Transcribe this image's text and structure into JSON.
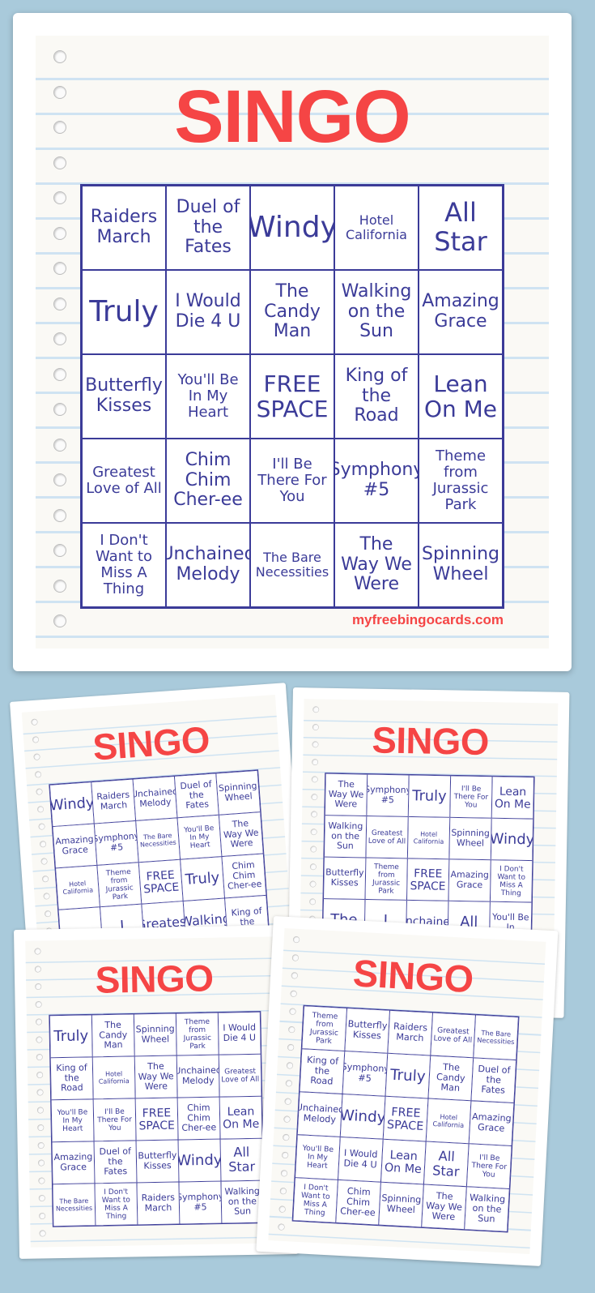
{
  "colors": {
    "background": "#a9cadb",
    "title": "#f54545",
    "grid": "#3b3b98",
    "rule_lines": "#cfe3f2"
  },
  "cards": [
    {
      "title": "SINGO",
      "site": "myfreebingocards.com",
      "cells": [
        "Raiders March",
        "Duel of the Fates",
        "Windy",
        "Hotel California",
        "All Star",
        "Truly",
        "I Would Die 4 U",
        "The Candy Man",
        "Walking on the Sun",
        "Amazing Grace",
        "Butterfly Kisses",
        "You'll Be In My Heart",
        "FREE SPACE",
        "King of the Road",
        "Lean On Me",
        "Greatest Love of All",
        "Chim Chim Cher-ee",
        "I'll Be There For You",
        "Symphony #5",
        "Theme from Jurassic Park",
        "I Don't Want to Miss A Thing",
        "Unchained Melody",
        "The Bare Necessities",
        "The Way We Were",
        "Spinning Wheel"
      ]
    },
    {
      "title": "SINGO",
      "cells": [
        "Windy",
        "Raiders March",
        "Unchained Melody",
        "Duel of the Fates",
        "Spinning Wheel",
        "Amazing Grace",
        "Symphony #5",
        "The Bare Necessities",
        "You'll Be In My Heart",
        "The Way We Were",
        "Hotel California",
        "Theme from Jurassic Park",
        "FREE SPACE",
        "Truly",
        "Chim Chim Cher-ee",
        "",
        "I",
        "Greatest",
        "Walking",
        "King of the",
        "",
        "",
        "",
        "",
        ""
      ]
    },
    {
      "title": "SINGO",
      "cells": [
        "The Way We Were",
        "Symphony #5",
        "Truly",
        "I'll Be There For You",
        "Lean On Me",
        "Walking on the Sun",
        "Greatest Love of All",
        "Hotel California",
        "Spinning Wheel",
        "Windy",
        "Butterfly Kisses",
        "Theme from Jurassic Park",
        "FREE SPACE",
        "Amazing Grace",
        "I Don't Want to Miss A Thing",
        "The",
        "I",
        "Unchained",
        "All",
        "You'll Be In",
        "",
        "",
        "",
        "",
        ""
      ]
    },
    {
      "title": "SINGO",
      "cells": [
        "Truly",
        "The Candy Man",
        "Spinning Wheel",
        "Theme from Jurassic Park",
        "I Would Die 4 U",
        "King of the Road",
        "Hotel California",
        "The Way We Were",
        "Unchained Melody",
        "Greatest Love of All",
        "You'll Be In My Heart",
        "I'll Be There For You",
        "FREE SPACE",
        "Chim Chim Cher-ee",
        "Lean On Me",
        "Amazing Grace",
        "Duel of the Fates",
        "Butterfly Kisses",
        "Windy",
        "All Star",
        "The Bare Necessities",
        "I Don't Want to Miss A Thing",
        "Raiders March",
        "Symphony #5",
        "Walking on the Sun"
      ]
    },
    {
      "title": "SINGO",
      "cells": [
        "Theme from Jurassic Park",
        "Butterfly Kisses",
        "Raiders March",
        "Greatest Love of All",
        "The Bare Necessities",
        "King of the Road",
        "Symphony #5",
        "Truly",
        "The Candy Man",
        "Duel of the Fates",
        "Unchained Melody",
        "Windy",
        "FREE SPACE",
        "Hotel California",
        "Amazing Grace",
        "You'll Be In My Heart",
        "I Would Die 4 U",
        "Lean On Me",
        "All Star",
        "I'll Be There For You",
        "I Don't Want to Miss A Thing",
        "Chim Chim Cher-ee",
        "Spinning Wheel",
        "The Way We Were",
        "Walking on the Sun"
      ]
    }
  ]
}
